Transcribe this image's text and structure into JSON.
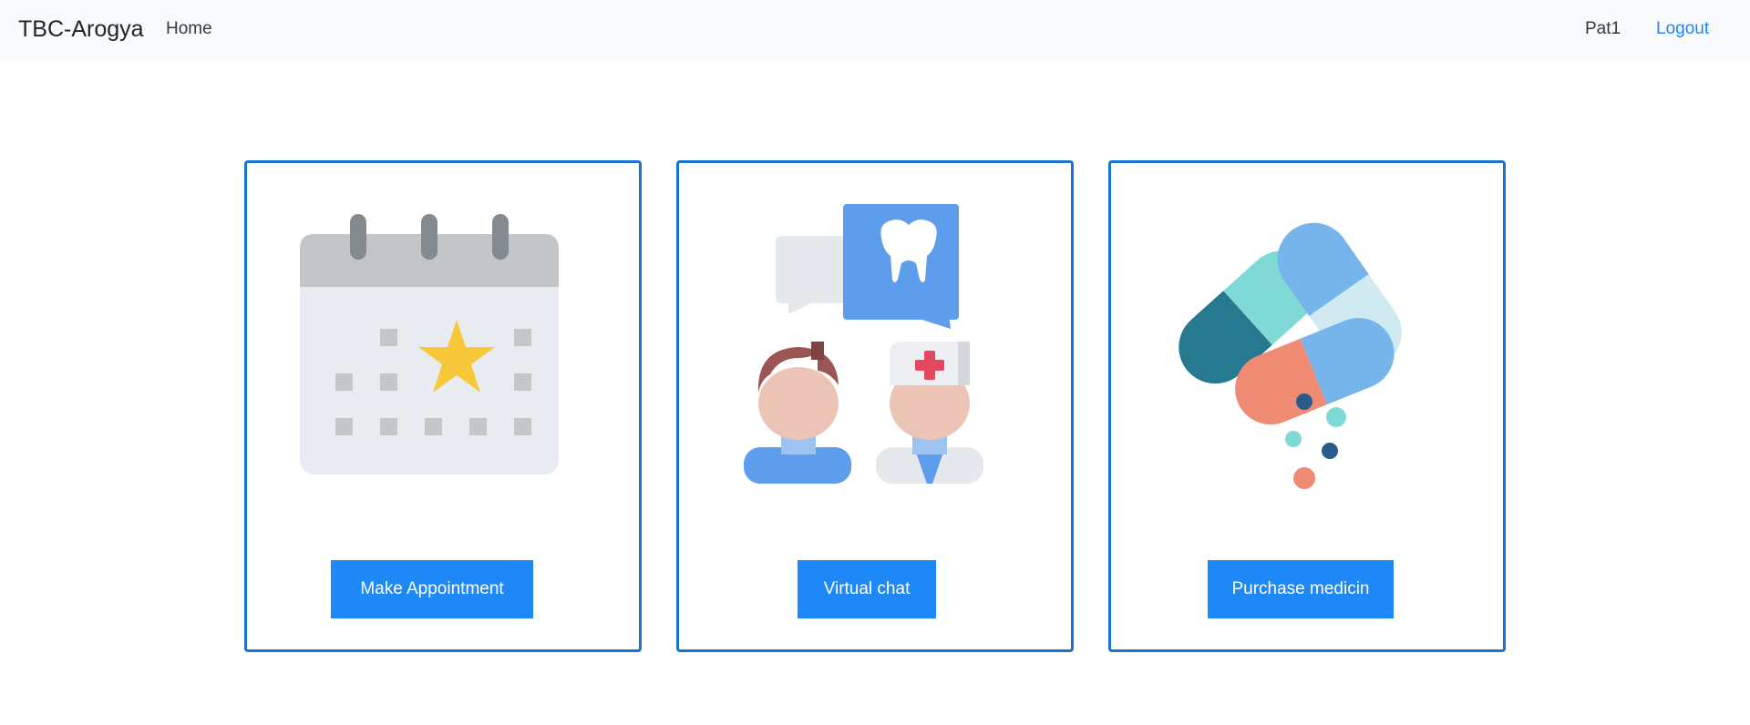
{
  "navbar": {
    "brand": "TBC-Arogya",
    "home_label": "Home",
    "user_label": "Pat1",
    "logout_label": "Logout"
  },
  "cards": [
    {
      "button_label": "Make Appointment",
      "icon": "calendar-star-icon"
    },
    {
      "button_label": "Virtual chat",
      "icon": "doctor-patient-chat-icon"
    },
    {
      "button_label": "Purchase medicin",
      "icon": "pills-capsules-icon"
    }
  ],
  "colors": {
    "accent": "#1e88f7",
    "card_border": "#1a73d1",
    "navbar_bg": "#f8f9fa"
  }
}
